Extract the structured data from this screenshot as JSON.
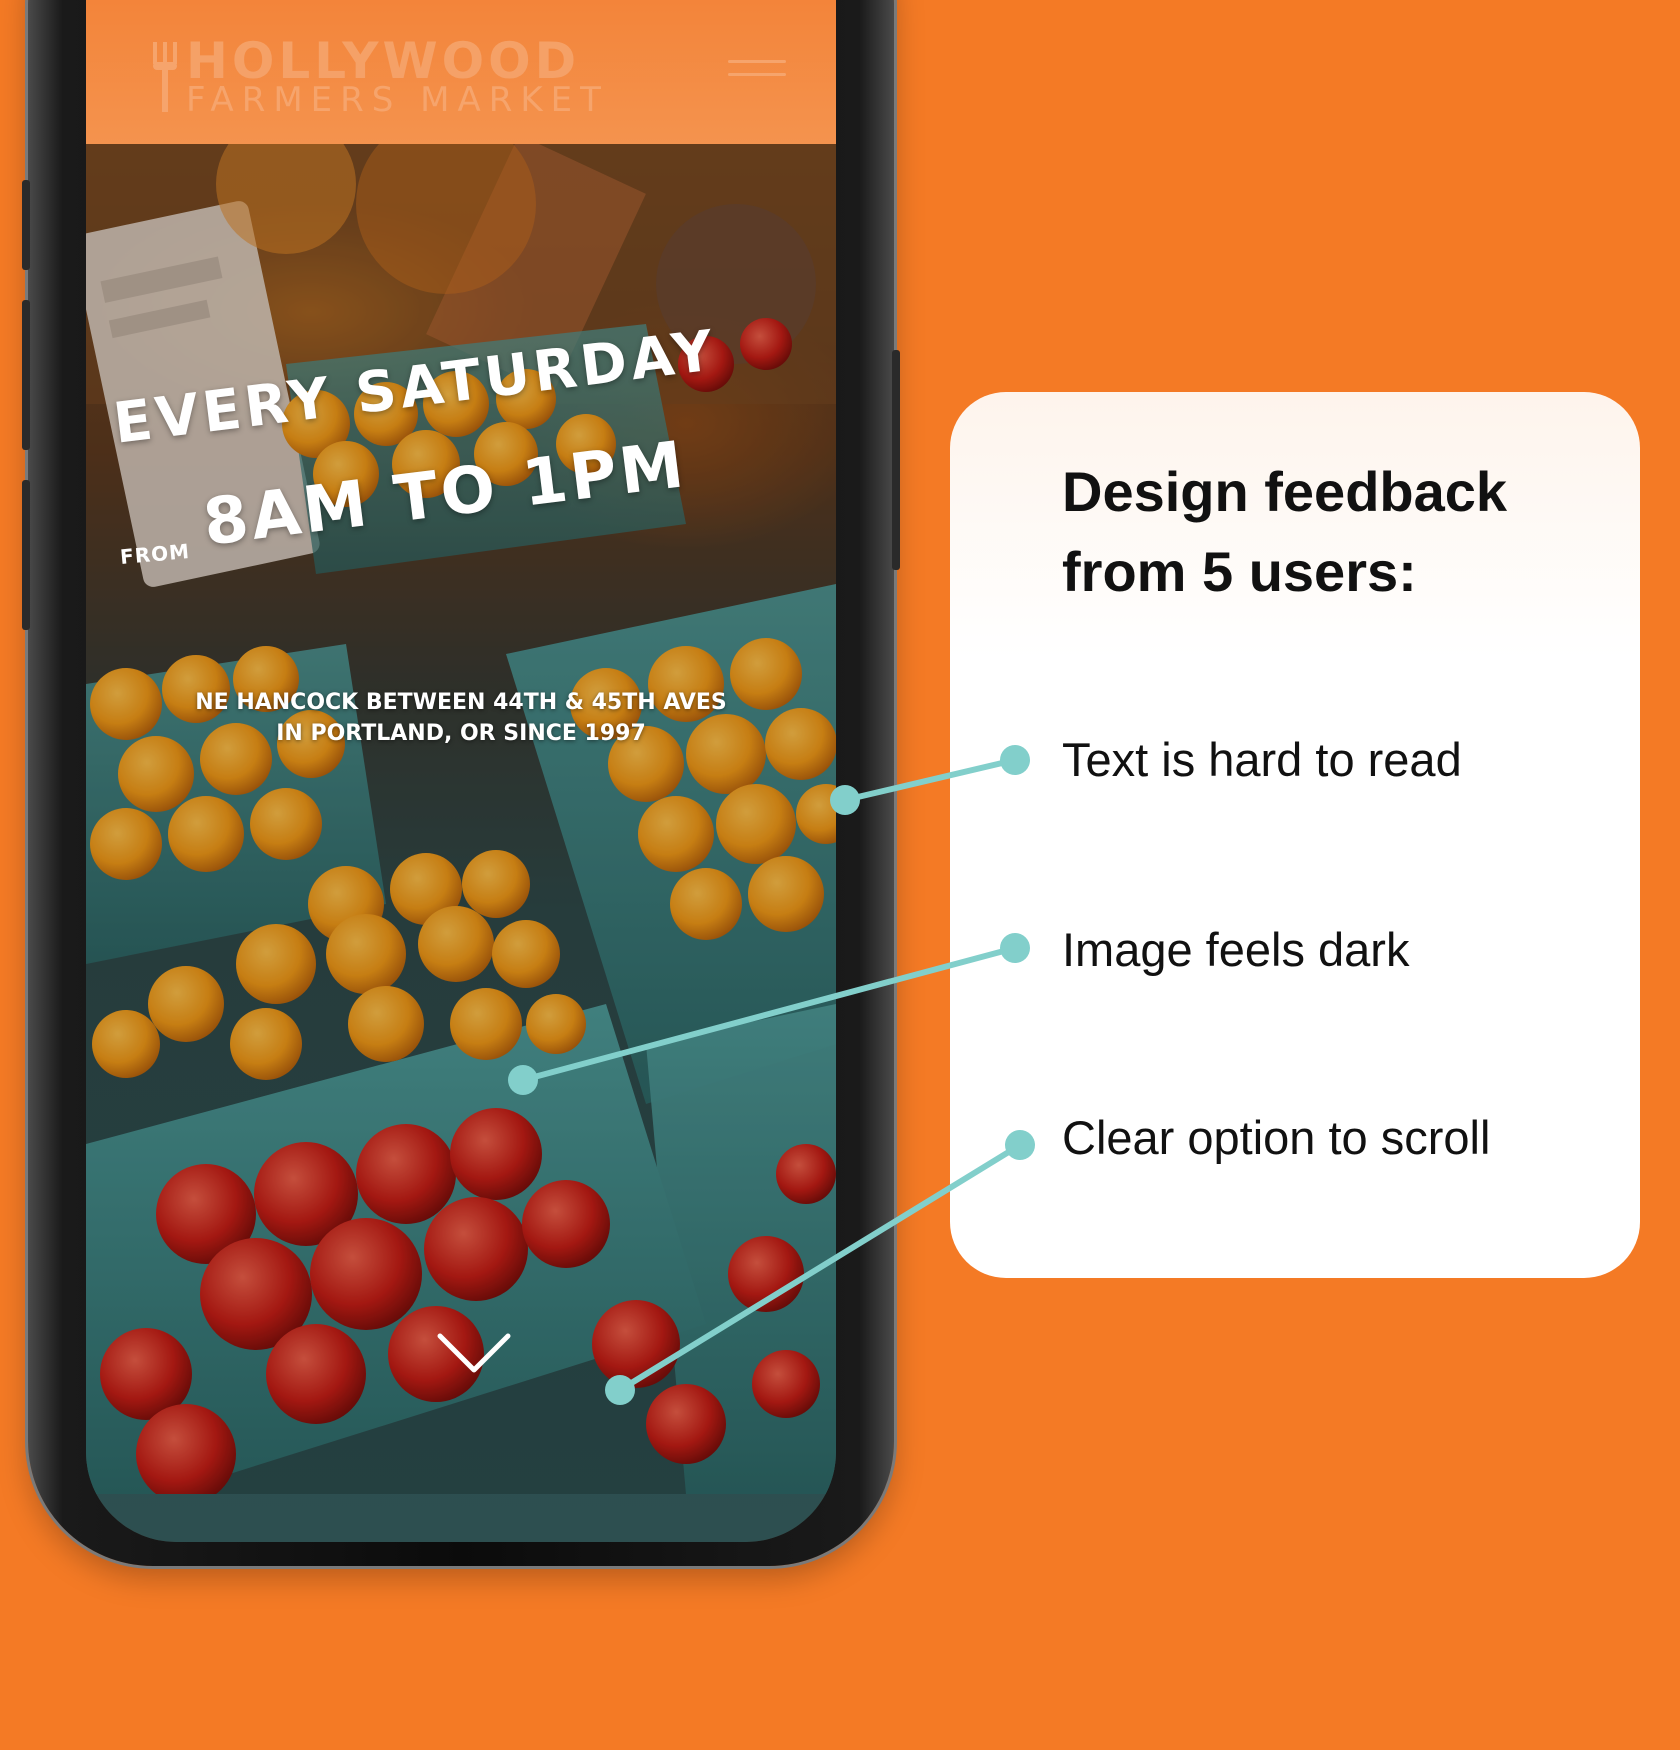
{
  "site": {
    "logo_line1": "HOLLYWOOD",
    "logo_line2": "FARMERS MARKET"
  },
  "hero": {
    "headline_line1": "EVERY SATURDAY",
    "from_label": "FROM",
    "headline_line2": "8AM TO 1PM",
    "address_line1": "NE HANCOCK BETWEEN 44TH & 45TH AVES",
    "address_line2": "IN PORTLAND, OR SINCE 1997"
  },
  "feedback": {
    "title": "Design feedback from 5 users:",
    "items": [
      "Text is hard to read",
      "Image feels dark",
      "Clear option to scroll"
    ]
  },
  "colors": {
    "background": "#F47A25",
    "callout": "#82CFCB",
    "card": "#FFFFFF",
    "text": "#111111"
  },
  "icons": {
    "menu": "hamburger-menu-icon",
    "scroll": "chevron-down-icon",
    "logo_mark": "fork-icon"
  }
}
